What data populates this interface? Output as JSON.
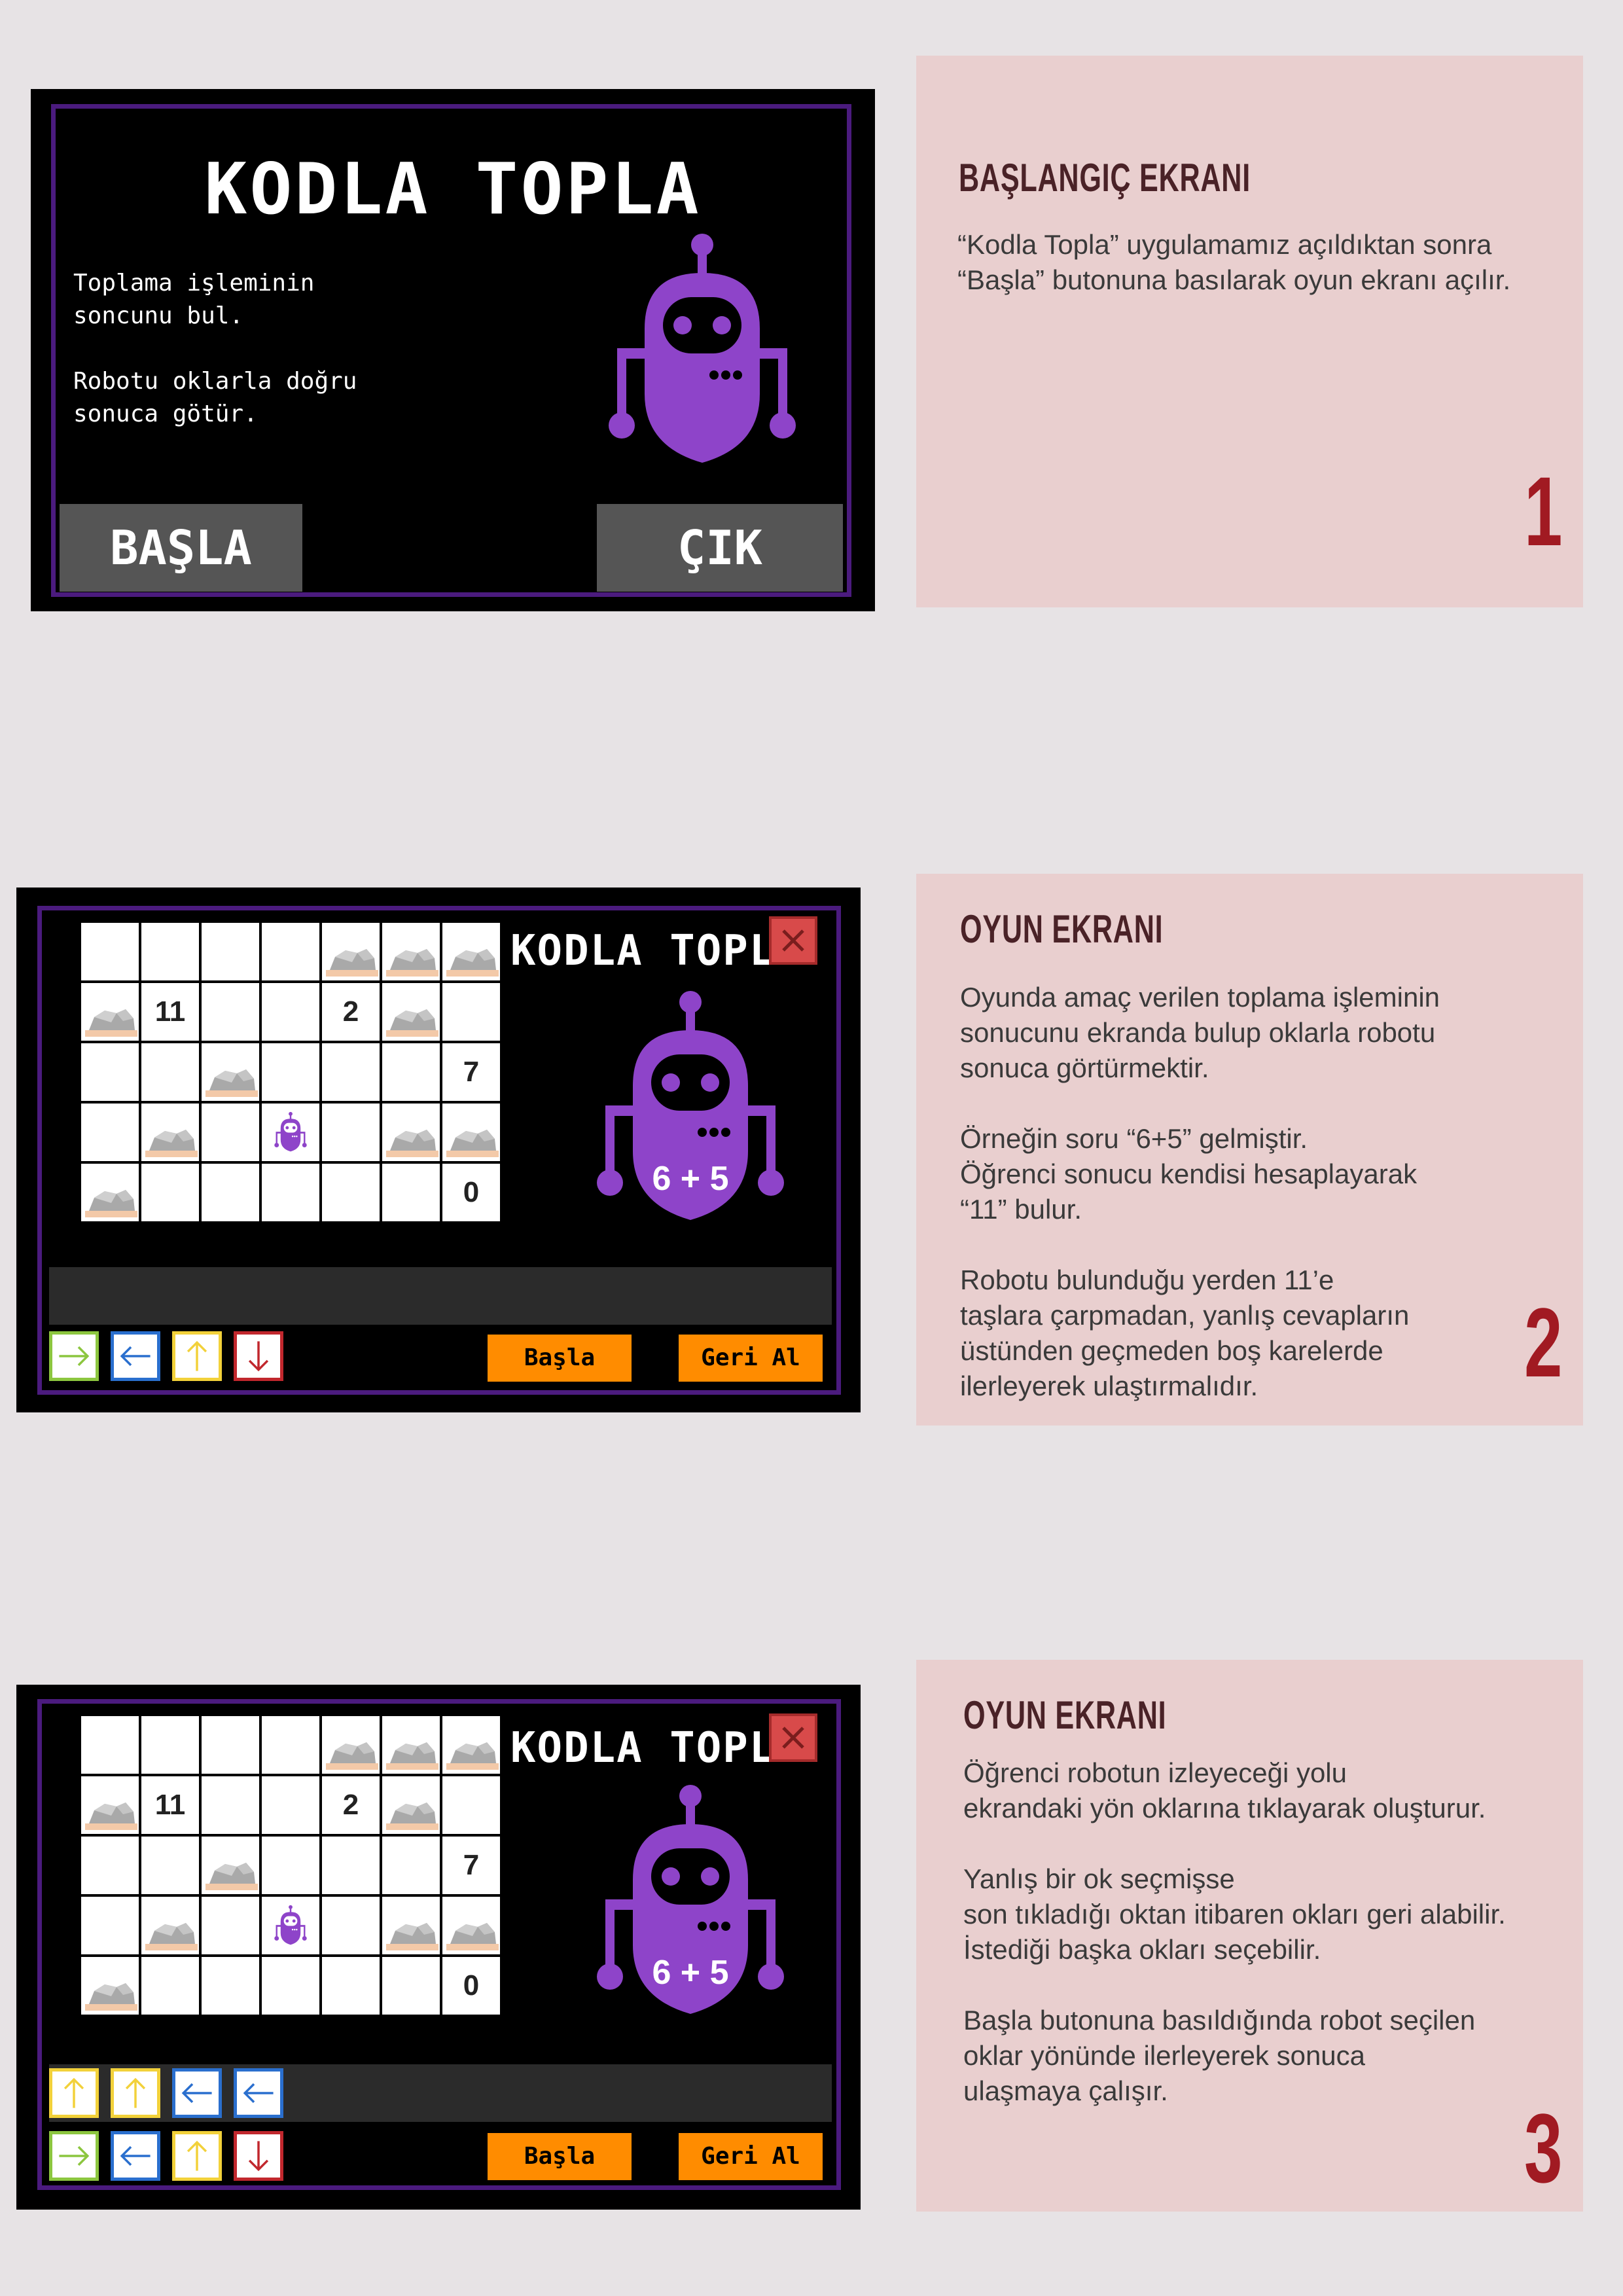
{
  "start_screen": {
    "title": "KODLA TOPLA",
    "paragraph1": "Toplama işleminin\nsoncunu bul.",
    "paragraph2": "Robotu oklarla doğru\nsonuca götür.",
    "start_button": "BAŞLA",
    "exit_button": "ÇIK"
  },
  "game": {
    "title": "KODLA TOPLA",
    "question": "6 + 5",
    "grid": [
      [
        "",
        "",
        "",
        "",
        "rock",
        "rock",
        "rock"
      ],
      [
        "rock",
        "11",
        "",
        "",
        "2",
        "rock",
        ""
      ],
      [
        "",
        "",
        "rock",
        "",
        "",
        "",
        "7"
      ],
      [
        "",
        "rock",
        "",
        "robot",
        "",
        "rock",
        "rock"
      ],
      [
        "rock",
        "",
        "",
        "",
        "",
        "",
        "0"
      ]
    ],
    "start_label": "Başla",
    "undo_label": "Geri Al",
    "arrow_buttons": [
      "right",
      "left",
      "up",
      "down"
    ],
    "selected_path": [
      "up",
      "up",
      "left",
      "left"
    ]
  },
  "colors": {
    "right": "#8cc63f",
    "left": "#2a6fce",
    "up": "#f2d13a",
    "down": "#c1272d",
    "robot": "#8e44c9",
    "button": "#ff8c00"
  },
  "panels": [
    {
      "title": "BAŞLANGIÇ EKRANI",
      "body": "“Kodla Topla” uygulamamız açıldıktan sonra\n“Başla” butonuna basılarak oyun ekranı açılır.",
      "number": "1"
    },
    {
      "title": "OYUN EKRANI",
      "body": "Oyunda amaç verilen toplama işleminin\nsonucunu ekranda bulup oklarla robotu\nsonuca görtürmektir.\n\nÖrneğin soru “6+5” gelmiştir.\nÖğrenci sonucu kendisi hesaplayarak\n“11” bulur.\n\nRobotu bulunduğu yerden 11’e\ntaşlara çarpmadan, yanlış cevapların\nüstünden geçmeden boş karelerde\nilerleyerek ulaştırmalıdır.",
      "number": "2"
    },
    {
      "title": "OYUN EKRANI",
      "body": "Öğrenci robotun izleyeceği yolu\nekrandaki yön oklarına tıklayarak oluşturur.\n\nYanlış bir ok seçmişse\nson tıkladığı oktan itibaren okları geri alabilir.\nİstediği başka okları seçebilir.\n\nBaşla butonuna basıldığında robot seçilen\noklar yönünde ilerleyerek sonuca\nulaşmaya çalışır.",
      "number": "3"
    }
  ]
}
